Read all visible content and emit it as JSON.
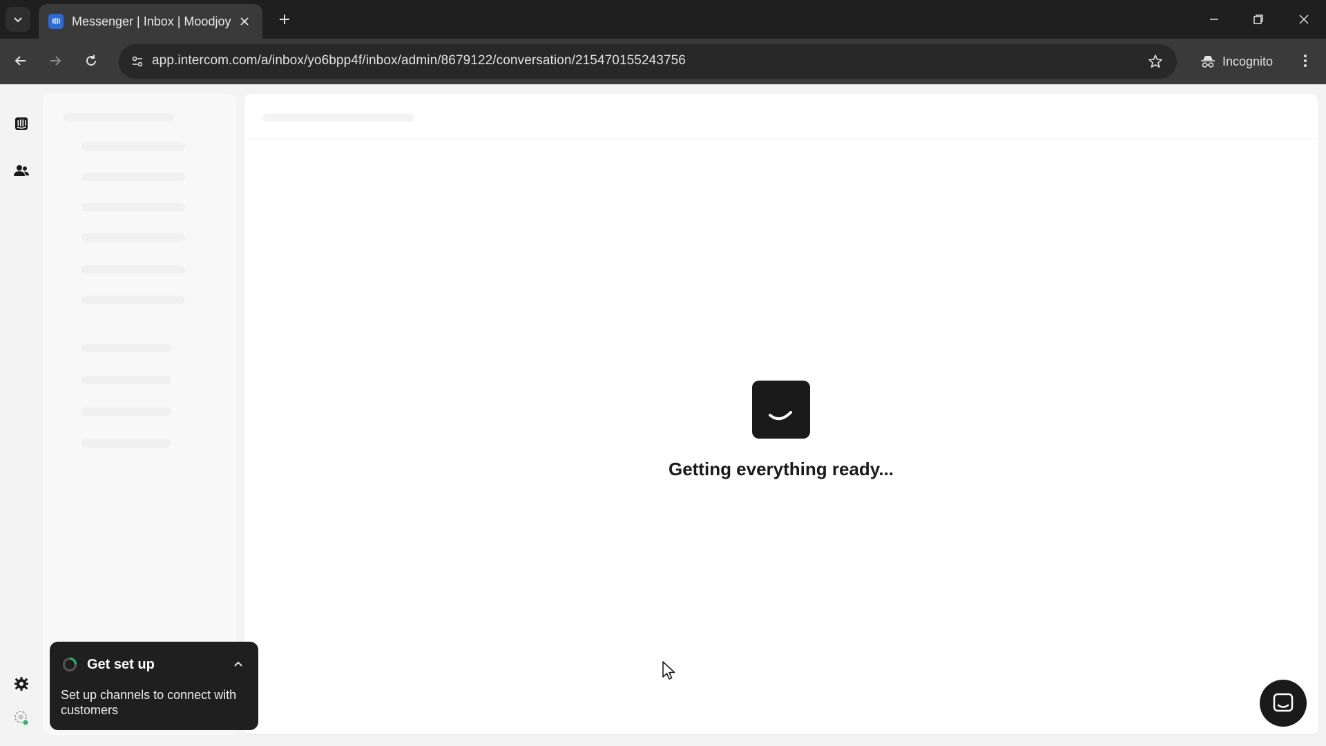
{
  "browser": {
    "tab": {
      "title": "Messenger | Inbox | Moodjoy | I"
    },
    "url": "app.intercom.com/a/inbox/yo6bpp4f/inbox/admin/8679122/conversation/215470155243756",
    "incognito_label": "Incognito",
    "icons": {
      "tab_list": "chevron-down-icon",
      "tab_close": "close-icon",
      "new_tab": "plus-icon",
      "minimize": "minimize-icon",
      "restore": "restore-icon",
      "close_window": "close-icon",
      "back": "arrow-left-icon",
      "forward": "arrow-right-icon",
      "reload": "reload-icon",
      "site_info": "tune-icon",
      "bookmark": "star-icon",
      "incognito": "incognito-icon",
      "menu": "more-vertical-icon"
    }
  },
  "app": {
    "rail": {
      "top_items": [
        "inbox-icon",
        "contacts-icon"
      ],
      "bottom_items": [
        "settings-icon",
        "status-avatar-icon"
      ]
    },
    "loading": {
      "text": "Getting everything ready..."
    },
    "setup_card": {
      "title": "Get set up",
      "description": "Set up channels to connect with customers"
    },
    "colors": {
      "tab_favicon": "#2a6bd6",
      "loader_bg": "#1a1a1a",
      "setup_card_bg": "#1f1f1f",
      "status_dot": "#2bb673"
    }
  }
}
